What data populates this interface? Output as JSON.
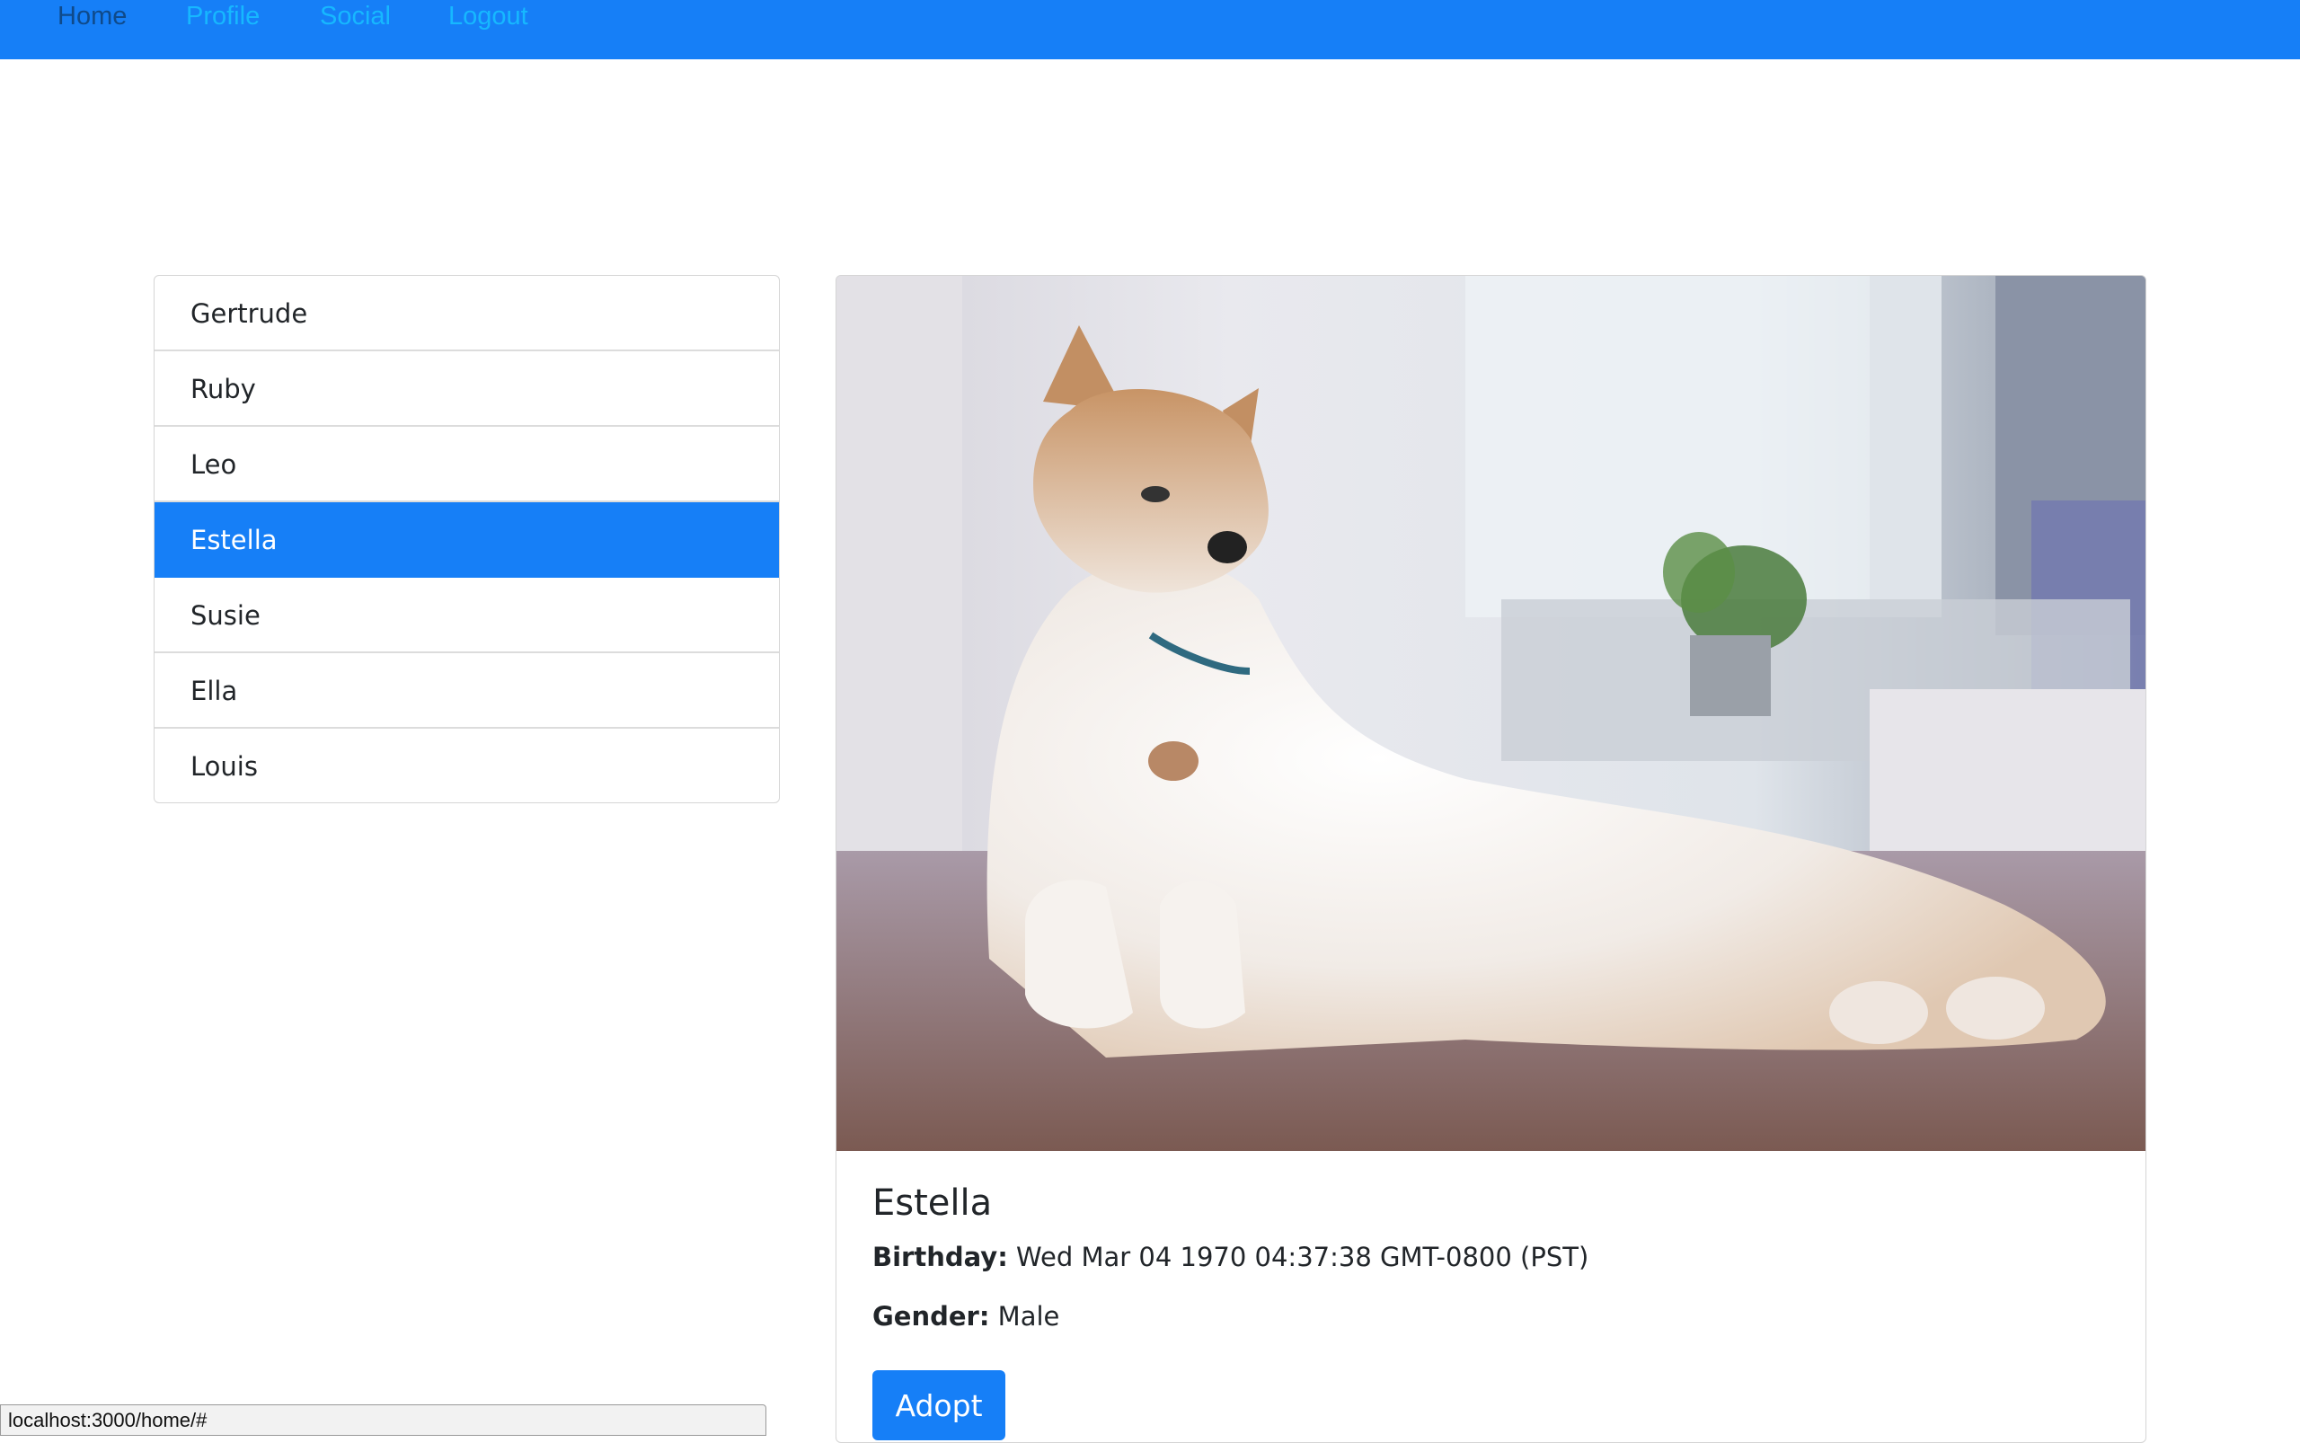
{
  "nav": {
    "home": "Home",
    "profile": "Profile",
    "social": "Social",
    "logout": "Logout"
  },
  "pets": [
    "Gertrude",
    "Ruby",
    "Leo",
    "Estella",
    "Susie",
    "Ella",
    "Louis"
  ],
  "selected_pet": "Estella",
  "card": {
    "image_subject": "akita-dog-photo",
    "name": "Estella",
    "birthday_label": "Birthday:",
    "birthday_value": "Wed Mar 04 1970 04:37:38 GMT-0800 (PST)",
    "gender_label": "Gender:",
    "gender_value": "Male",
    "adopt_label": "Adopt"
  },
  "status_bar": {
    "url": "localhost:3000/home/#"
  },
  "colors": {
    "primary": "#167ff7",
    "nav_active_text": "#0f4a8a",
    "nav_text": "#16b8ff"
  }
}
